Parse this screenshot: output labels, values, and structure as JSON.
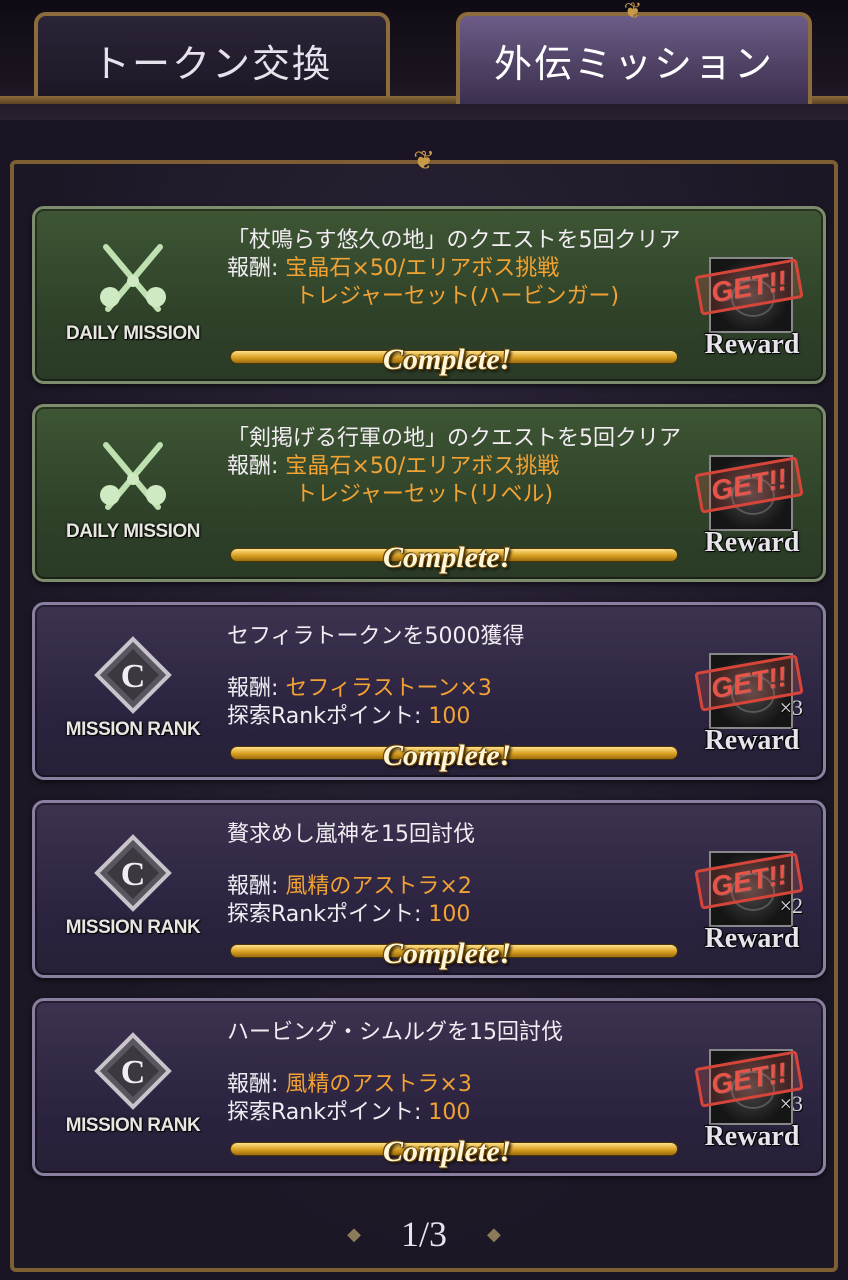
{
  "tabs": [
    {
      "label": "トークン交換",
      "active": false
    },
    {
      "label": "外伝ミッション",
      "active": true
    }
  ],
  "missions": [
    {
      "type": "daily",
      "badge": "DAILY MISSION",
      "title": "「杖鳴らす悠久の地」のクエストを5回クリア",
      "reward_label": "報酬: ",
      "reward_value": "宝晶石×50/エリアボス挑戦",
      "reward_value2": "トレジャーセット(ハービンガー)",
      "status": "Complete!",
      "stamp": "GET!!",
      "reward_button": "Reward",
      "multiplier": ""
    },
    {
      "type": "daily",
      "badge": "DAILY MISSION",
      "title": "「剣掲げる行軍の地」のクエストを5回クリア",
      "reward_label": "報酬: ",
      "reward_value": "宝晶石×50/エリアボス挑戦",
      "reward_value2": "トレジャーセット(リベル)",
      "status": "Complete!",
      "stamp": "GET!!",
      "reward_button": "Reward",
      "multiplier": ""
    },
    {
      "type": "rank",
      "badge": "MISSION RANK",
      "rank_letter": "C",
      "title": "セフィラトークンを5000獲得",
      "reward_label": "報酬: ",
      "reward_value": "セフィラストーン×3",
      "points_label": "探索Rankポイント: ",
      "points_value": "100",
      "status": "Complete!",
      "stamp": "GET!!",
      "reward_button": "Reward",
      "multiplier": "×3"
    },
    {
      "type": "rank",
      "badge": "MISSION RANK",
      "rank_letter": "C",
      "title": "贅求めし嵐神を15回討伐",
      "reward_label": "報酬: ",
      "reward_value": "風精のアストラ×2",
      "points_label": "探索Rankポイント: ",
      "points_value": "100",
      "status": "Complete!",
      "stamp": "GET!!",
      "reward_button": "Reward",
      "multiplier": "×2"
    },
    {
      "type": "rank",
      "badge": "MISSION RANK",
      "rank_letter": "C",
      "title": "ハービング・シムルグを15回討伐",
      "reward_label": "報酬: ",
      "reward_value": "風精のアストラ×3",
      "points_label": "探索Rankポイント: ",
      "points_value": "100",
      "status": "Complete!",
      "stamp": "GET!!",
      "reward_button": "Reward",
      "multiplier": "×3"
    }
  ],
  "pager": {
    "text": "1/3"
  },
  "colors": {
    "accent_gold": "#c79a48",
    "reward_orange": "#f2a233",
    "stamp_red": "#d5453a"
  }
}
